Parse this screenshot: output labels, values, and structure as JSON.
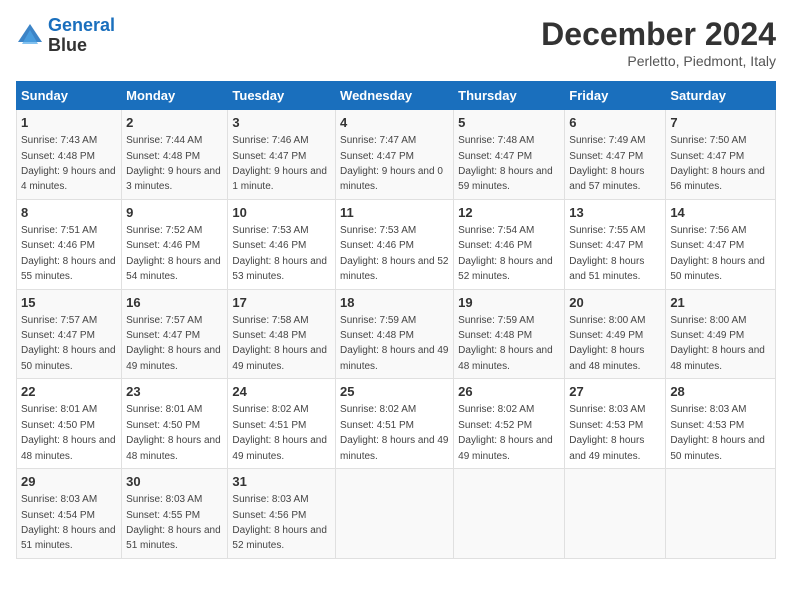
{
  "header": {
    "logo_line1": "General",
    "logo_line2": "Blue",
    "title": "December 2024",
    "subtitle": "Perletto, Piedmont, Italy"
  },
  "days_of_week": [
    "Sunday",
    "Monday",
    "Tuesday",
    "Wednesday",
    "Thursday",
    "Friday",
    "Saturday"
  ],
  "weeks": [
    [
      {
        "day": "1",
        "sunrise": "7:43 AM",
        "sunset": "4:48 PM",
        "daylight": "9 hours and 4 minutes."
      },
      {
        "day": "2",
        "sunrise": "7:44 AM",
        "sunset": "4:48 PM",
        "daylight": "9 hours and 3 minutes."
      },
      {
        "day": "3",
        "sunrise": "7:46 AM",
        "sunset": "4:47 PM",
        "daylight": "9 hours and 1 minute."
      },
      {
        "day": "4",
        "sunrise": "7:47 AM",
        "sunset": "4:47 PM",
        "daylight": "9 hours and 0 minutes."
      },
      {
        "day": "5",
        "sunrise": "7:48 AM",
        "sunset": "4:47 PM",
        "daylight": "8 hours and 59 minutes."
      },
      {
        "day": "6",
        "sunrise": "7:49 AM",
        "sunset": "4:47 PM",
        "daylight": "8 hours and 57 minutes."
      },
      {
        "day": "7",
        "sunrise": "7:50 AM",
        "sunset": "4:47 PM",
        "daylight": "8 hours and 56 minutes."
      }
    ],
    [
      {
        "day": "8",
        "sunrise": "7:51 AM",
        "sunset": "4:46 PM",
        "daylight": "8 hours and 55 minutes."
      },
      {
        "day": "9",
        "sunrise": "7:52 AM",
        "sunset": "4:46 PM",
        "daylight": "8 hours and 54 minutes."
      },
      {
        "day": "10",
        "sunrise": "7:53 AM",
        "sunset": "4:46 PM",
        "daylight": "8 hours and 53 minutes."
      },
      {
        "day": "11",
        "sunrise": "7:53 AM",
        "sunset": "4:46 PM",
        "daylight": "8 hours and 52 minutes."
      },
      {
        "day": "12",
        "sunrise": "7:54 AM",
        "sunset": "4:46 PM",
        "daylight": "8 hours and 52 minutes."
      },
      {
        "day": "13",
        "sunrise": "7:55 AM",
        "sunset": "4:47 PM",
        "daylight": "8 hours and 51 minutes."
      },
      {
        "day": "14",
        "sunrise": "7:56 AM",
        "sunset": "4:47 PM",
        "daylight": "8 hours and 50 minutes."
      }
    ],
    [
      {
        "day": "15",
        "sunrise": "7:57 AM",
        "sunset": "4:47 PM",
        "daylight": "8 hours and 50 minutes."
      },
      {
        "day": "16",
        "sunrise": "7:57 AM",
        "sunset": "4:47 PM",
        "daylight": "8 hours and 49 minutes."
      },
      {
        "day": "17",
        "sunrise": "7:58 AM",
        "sunset": "4:48 PM",
        "daylight": "8 hours and 49 minutes."
      },
      {
        "day": "18",
        "sunrise": "7:59 AM",
        "sunset": "4:48 PM",
        "daylight": "8 hours and 49 minutes."
      },
      {
        "day": "19",
        "sunrise": "7:59 AM",
        "sunset": "4:48 PM",
        "daylight": "8 hours and 48 minutes."
      },
      {
        "day": "20",
        "sunrise": "8:00 AM",
        "sunset": "4:49 PM",
        "daylight": "8 hours and 48 minutes."
      },
      {
        "day": "21",
        "sunrise": "8:00 AM",
        "sunset": "4:49 PM",
        "daylight": "8 hours and 48 minutes."
      }
    ],
    [
      {
        "day": "22",
        "sunrise": "8:01 AM",
        "sunset": "4:50 PM",
        "daylight": "8 hours and 48 minutes."
      },
      {
        "day": "23",
        "sunrise": "8:01 AM",
        "sunset": "4:50 PM",
        "daylight": "8 hours and 48 minutes."
      },
      {
        "day": "24",
        "sunrise": "8:02 AM",
        "sunset": "4:51 PM",
        "daylight": "8 hours and 49 minutes."
      },
      {
        "day": "25",
        "sunrise": "8:02 AM",
        "sunset": "4:51 PM",
        "daylight": "8 hours and 49 minutes."
      },
      {
        "day": "26",
        "sunrise": "8:02 AM",
        "sunset": "4:52 PM",
        "daylight": "8 hours and 49 minutes."
      },
      {
        "day": "27",
        "sunrise": "8:03 AM",
        "sunset": "4:53 PM",
        "daylight": "8 hours and 49 minutes."
      },
      {
        "day": "28",
        "sunrise": "8:03 AM",
        "sunset": "4:53 PM",
        "daylight": "8 hours and 50 minutes."
      }
    ],
    [
      {
        "day": "29",
        "sunrise": "8:03 AM",
        "sunset": "4:54 PM",
        "daylight": "8 hours and 51 minutes."
      },
      {
        "day": "30",
        "sunrise": "8:03 AM",
        "sunset": "4:55 PM",
        "daylight": "8 hours and 51 minutes."
      },
      {
        "day": "31",
        "sunrise": "8:03 AM",
        "sunset": "4:56 PM",
        "daylight": "8 hours and 52 minutes."
      },
      null,
      null,
      null,
      null
    ]
  ]
}
